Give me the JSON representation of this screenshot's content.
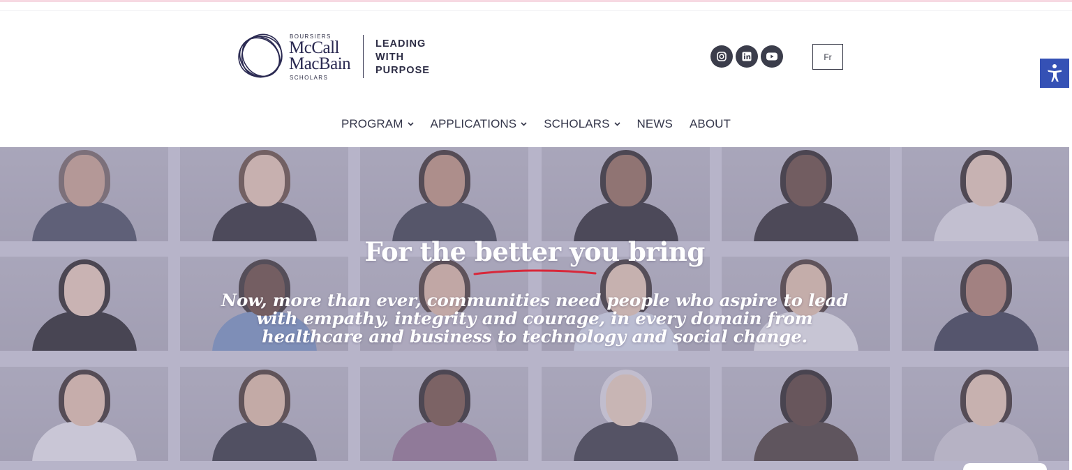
{
  "header": {
    "logo": {
      "small_top": "BOURSIERS",
      "name_line1": "McCall",
      "name_line2": "MacBain",
      "small_bottom": "SCHOLARS",
      "tagline": [
        "LEADING",
        "WITH",
        "PURPOSE"
      ]
    },
    "social": [
      {
        "icon": "instagram-icon"
      },
      {
        "icon": "linkedin-icon"
      },
      {
        "icon": "youtube-icon"
      }
    ],
    "language_button": "Fr",
    "accessibility_icon": "accessibility-icon"
  },
  "nav": {
    "items": [
      {
        "label": "PROGRAM",
        "has_dropdown": true
      },
      {
        "label": "APPLICATIONS",
        "has_dropdown": true
      },
      {
        "label": "SCHOLARS",
        "has_dropdown": true
      },
      {
        "label": "NEWS",
        "has_dropdown": false
      },
      {
        "label": "ABOUT",
        "has_dropdown": false
      }
    ]
  },
  "hero": {
    "title": "For the better you bring",
    "subtitle_lines": [
      "Now, more than ever, communities need people who aspire to lead",
      "with empathy, integrity and courage, in every domain from",
      "healthcare and business to technology and social change."
    ],
    "underline_color": "#d8283a"
  },
  "colors": {
    "accent": "#3551b5",
    "brand_navy": "#2b2a52",
    "icon_bg": "#3b3d4b",
    "hero_tint": "#c9c7d3"
  }
}
